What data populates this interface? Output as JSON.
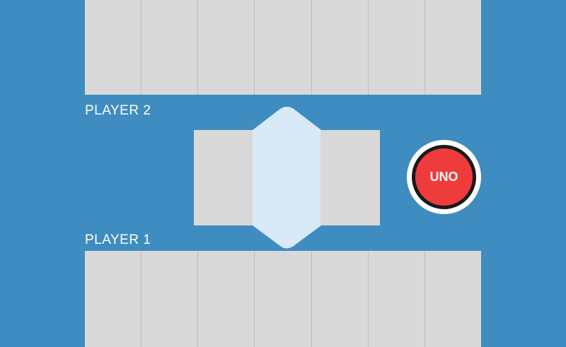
{
  "colors": {
    "table": "#3f8cc0",
    "card_back": "#d9d9d9",
    "center_slot": "#d8e9f8",
    "uno_button": "#ee3b3b"
  },
  "player2": {
    "label": "PLAYER 2",
    "card_count": 7
  },
  "player1": {
    "label": "PLAYER 1",
    "card_count": 7
  },
  "uno_button": {
    "label": "UNO"
  }
}
